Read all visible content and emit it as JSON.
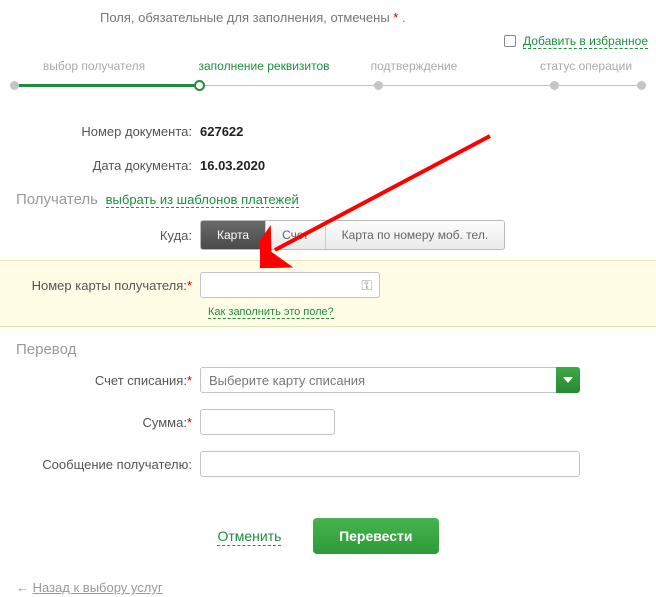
{
  "top_note": "Поля, обязательные для заполнения, отмечены",
  "top_note_mark": "*",
  "favorite_link": "Добавить в избранное",
  "steps": {
    "s1": "выбор получателя",
    "s2": "заполнение реквизитов",
    "s3": "подтверждение",
    "s4": "статус операции"
  },
  "doc": {
    "num_label": "Номер документа:",
    "num_value": "627622",
    "date_label": "Дата документа:",
    "date_value": "16.03.2020"
  },
  "recipient": {
    "title": "Получатель",
    "template_link": "выбрать из шаблонов платежей",
    "where_label": "Куда:",
    "tabs": {
      "card": "Карта",
      "account": "Счет",
      "phone": "Карта по номеру моб. тел."
    },
    "card_num_label": "Номер карты получателя:",
    "help_link": "Как заполнить это поле?"
  },
  "transfer": {
    "title": "Перевод",
    "writeoff_label": "Счет списания:",
    "writeoff_placeholder": "Выберите карту списания",
    "sum_label": "Сумма:",
    "message_label": "Сообщение получателю:"
  },
  "actions": {
    "cancel": "Отменить",
    "submit": "Перевести"
  },
  "back_arrow": "←",
  "back_link": "Назад к выбору услуг"
}
